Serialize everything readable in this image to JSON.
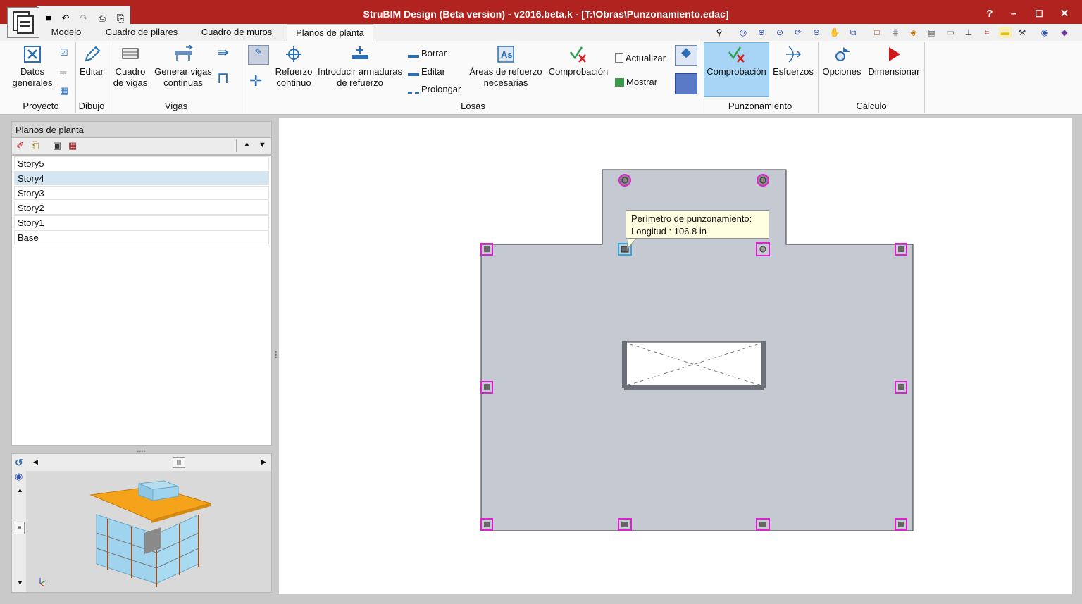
{
  "window": {
    "title": "StruBIM Design (Beta version) - v2016.beta.k - [T:\\Obras\\Punzonamiento.edac]",
    "help": "?",
    "minimize": "–",
    "maximize": "☐",
    "close": "✕"
  },
  "tabs": [
    "Modelo",
    "Cuadro de pilares",
    "Cuadro de muros",
    "Planos de planta"
  ],
  "ribbon": {
    "datos_generales_1": "Datos",
    "datos_generales_2": "generales",
    "editar": "Editar",
    "cuadro_vigas_1": "Cuadro",
    "cuadro_vigas_2": "de vigas",
    "generar_vigas_1": "Generar vigas",
    "generar_vigas_2": "continuas",
    "refuerzo_1": "Refuerzo",
    "refuerzo_2": "continuo",
    "introducir_1": "Introducir armaduras",
    "introducir_2": "de refuerzo",
    "borrar": "Borrar",
    "editar_small": "Editar",
    "prolongar": "Prolongar",
    "areas_1": "Áreas de refuerzo",
    "areas_2": "necesarias",
    "comprobacion": "Comprobación",
    "actualizar": "Actualizar",
    "mostrar": "Mostrar",
    "comprobacion_p": "Comprobación",
    "esfuerzos": "Esfuerzos",
    "opciones": "Opciones",
    "dimensionar": "Dimensionar",
    "groups": [
      "Proyecto",
      "Dibujo",
      "Vigas",
      "Losas",
      "Punzonamiento",
      "Cálculo"
    ]
  },
  "left_panel": {
    "title": "Planos de planta",
    "stories": [
      "Story5",
      "Story4",
      "Story3",
      "Story2",
      "Story1",
      "Base"
    ],
    "selected": "Story4"
  },
  "tooltip": {
    "line1": "Perímetro de punzonamiento:",
    "line2": "Longitud : 106.8 in"
  },
  "colors": {
    "titlebar": "#b0231f",
    "slab": "#c5c9d1",
    "column_outline": "#e020d0",
    "selected_column": "#2fa8e0",
    "active_ribbon": "#a8d5f5",
    "model_orange": "#f5a31a",
    "model_glass": "#9fd3ee"
  }
}
